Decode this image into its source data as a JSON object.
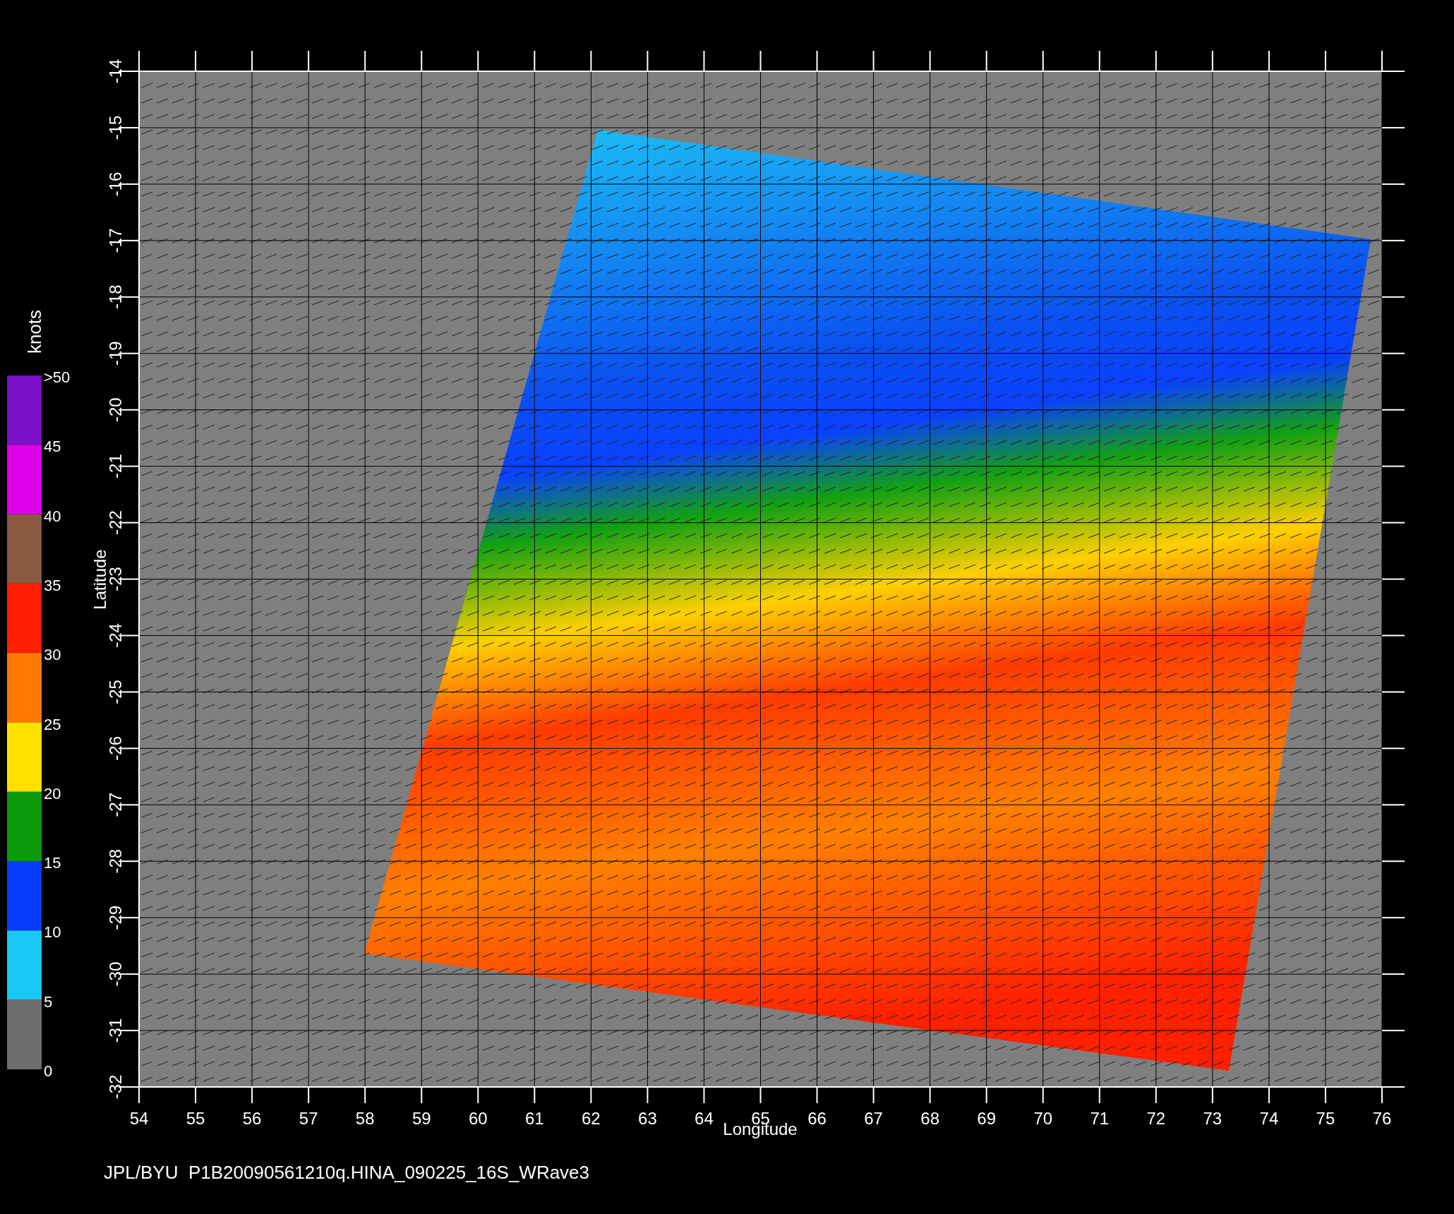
{
  "plot": {
    "x_axis": {
      "label": "Longitude",
      "ticks": [
        "54",
        "55",
        "56",
        "57",
        "58",
        "59",
        "60",
        "61",
        "62",
        "63",
        "64",
        "65",
        "66",
        "67",
        "68",
        "69",
        "70",
        "71",
        "72",
        "73",
        "74",
        "75",
        "76"
      ]
    },
    "y_axis": {
      "label": "Latitude",
      "ticks": [
        "-14",
        "-15",
        "-16",
        "-17",
        "-18",
        "-19",
        "-20",
        "-21",
        "-22",
        "-23",
        "-24",
        "-25",
        "-26",
        "-27",
        "-28",
        "-29",
        "-30",
        "-31",
        "-32"
      ]
    }
  },
  "colorbar": {
    "unit": "knots",
    "labels": [
      ">50",
      "45",
      "40",
      "35",
      "30",
      "25",
      "20",
      "15",
      "10",
      "5",
      "0"
    ],
    "segments": [
      {
        "color": "#7a10c8"
      },
      {
        "color": "#e000e8"
      },
      {
        "color": "#8a5a40"
      },
      {
        "color": "#ff1e00"
      },
      {
        "color": "#ff7a00"
      },
      {
        "color": "#ffe000"
      },
      {
        "color": "#0a9a0a"
      },
      {
        "color": "#0a3cff"
      },
      {
        "color": "#19c8f5"
      },
      {
        "color": "#6e6e6e"
      }
    ]
  },
  "footer": "JPL/BYU  P1B20090561210q.HINA_090225_16S_WRave3"
}
